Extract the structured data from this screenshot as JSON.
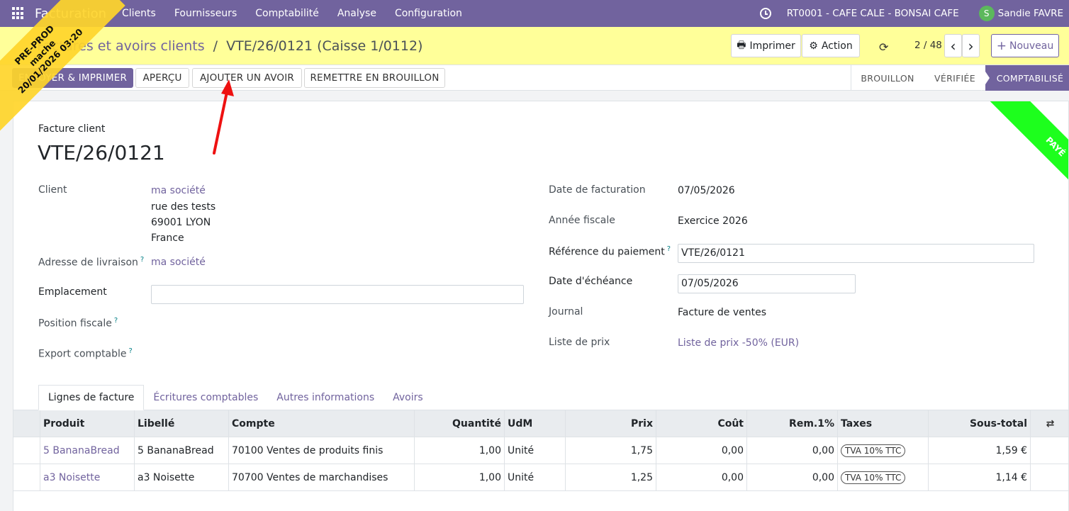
{
  "navbar": {
    "brand": "Facturation",
    "menu": [
      "Clients",
      "Fournisseurs",
      "Comptabilité",
      "Analyse",
      "Configuration"
    ],
    "company": "RT0001 - CAFE CALE - BONSAI CAFE",
    "user_initial": "S",
    "user_name": "Sandie FAVRE",
    "icons": {
      "apps": "apps-grid-icon",
      "activity": "clock-icon"
    }
  },
  "control_panel": {
    "breadcrumb_parent": "Factures et avoirs clients",
    "breadcrumb_sep": "/",
    "breadcrumb_current": "VTE/26/0121 (Caisse 1/0112)",
    "print_label": "Imprimer",
    "action_label": "Action",
    "pager": "2 / 48",
    "new_label": "Nouveau",
    "prev": "‹",
    "next": "›"
  },
  "statusbar": {
    "buttons": [
      "ENVOYER & IMPRIMER",
      "APERÇU",
      "AJOUTER UN AVOIR",
      "REMETTRE EN BROUILLON"
    ],
    "stages": [
      "BROUILLON",
      "VÉRIFIÉE",
      "COMPTABILISÉ"
    ],
    "active_stage": "COMPTABILISÉ"
  },
  "preprod": {
    "line1": "PRE-PROD",
    "line2": "mache",
    "line3": "20/01/2026 03:20"
  },
  "form": {
    "doc_type": "Facture client",
    "doc_number": "VTE/26/0121",
    "ribbon": "PAYÉ",
    "client_label": "Client",
    "client_name": "ma société",
    "client_street": "rue des tests",
    "client_city": "69001 LYON",
    "client_country": "France",
    "delivery_label": "Adresse de livraison",
    "delivery_value": "ma société",
    "location_label": "Emplacement",
    "location_value": "",
    "fiscal_position_label": "Position fiscale",
    "export_label": "Export comptable",
    "invoice_date_label": "Date de facturation",
    "invoice_date": "07/05/2026",
    "fiscal_year_label": "Année fiscale",
    "fiscal_year": "Exercice 2026",
    "payment_ref_label": "Référence du paiement",
    "payment_ref": "VTE/26/0121",
    "due_date_label": "Date d'échéance",
    "due_date": "07/05/2026",
    "journal_label": "Journal",
    "journal": "Facture de ventes",
    "pricelist_label": "Liste de prix",
    "pricelist": "Liste de prix -50% (EUR)",
    "help": "?"
  },
  "tabs": [
    "Lignes de facture",
    "Écritures comptables",
    "Autres informations",
    "Avoirs"
  ],
  "table": {
    "headers": [
      "Produit",
      "Libellé",
      "Compte",
      "Quantité",
      "UdM",
      "Prix",
      "Coût",
      "Rem.1%",
      "Taxes",
      "Sous-total"
    ],
    "rows": [
      {
        "product": "5 BananaBread",
        "label": "5 BananaBread",
        "account": "70100 Ventes de produits finis",
        "qty": "1,00",
        "uom": "Unité",
        "price": "1,75",
        "cost": "0,00",
        "discount": "0,00",
        "tax": "TVA 10% TTC",
        "subtotal": "1,59 €"
      },
      {
        "product": "a3 Noisette",
        "label": "a3 Noisette",
        "account": "70700 Ventes de marchandises",
        "qty": "1,00",
        "uom": "Unité",
        "price": "1,25",
        "cost": "0,00",
        "discount": "0,00",
        "tax": "TVA 10% TTC",
        "subtotal": "1,14 €"
      }
    ]
  }
}
